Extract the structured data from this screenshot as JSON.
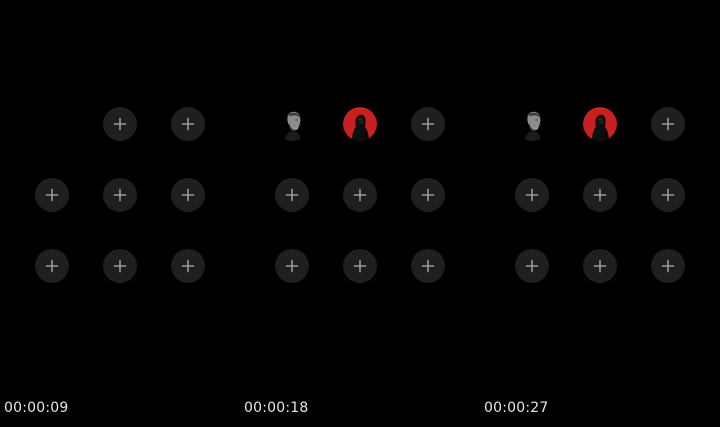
{
  "panels": [
    {
      "timestamp": "00:00:09",
      "slots": [
        "empty",
        "add",
        "add",
        "add",
        "add",
        "add",
        "add",
        "add",
        "add"
      ]
    },
    {
      "timestamp": "00:00:18",
      "slots": [
        "avatar-grey",
        "avatar-red",
        "add",
        "add",
        "add",
        "add",
        "add",
        "add",
        "add"
      ]
    },
    {
      "timestamp": "00:00:27",
      "slots": [
        "avatar-grey",
        "avatar-red",
        "add",
        "add",
        "add",
        "add",
        "add",
        "add",
        "add"
      ]
    }
  ],
  "icons": {
    "add": "plus-icon",
    "avatar-grey": "bearded-man-avatar",
    "avatar-red": "hooded-figure-red-avatar"
  },
  "colors": {
    "background": "#000000",
    "slot_fill": "#1f1f1f",
    "plus": "#9a9a9a",
    "avatar_red": "#c8201e",
    "timestamp_text": "#e6e6e6"
  }
}
